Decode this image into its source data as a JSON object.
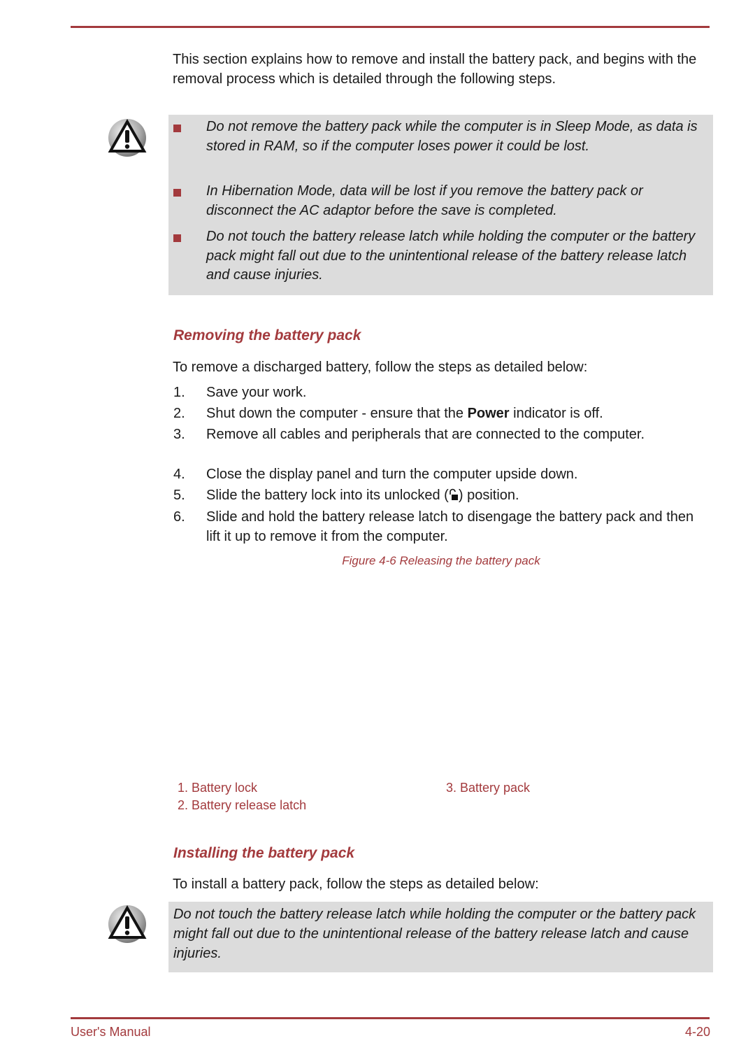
{
  "intro": "This section explains how to remove and install the battery pack, and begins with the removal process which is detailed through the following steps.",
  "caution_notes": [
    "Do not remove the battery pack while the computer is in Sleep Mode, as data is stored in RAM, so if the computer loses power it could be lost.",
    "In Hibernation Mode, data will be lost if you remove the battery pack or disconnect the AC adaptor before the save is completed.",
    "Do not touch the battery release latch while holding the computer or the battery pack might fall out due to the unintentional release of the battery release latch and cause injuries."
  ],
  "removing": {
    "heading": "Removing the battery pack",
    "lead": "To remove a discharged battery, follow the steps as detailed below:",
    "steps": [
      {
        "num": "1.",
        "text": "Save your work."
      },
      {
        "num": "2.",
        "pre": "Shut down the computer - ensure that the ",
        "bold": "Power",
        "post": " indicator is off."
      },
      {
        "num": "3.",
        "text": "Remove all cables and peripherals that are connected to the computer."
      },
      {
        "num": "4.",
        "text": "Close the display panel and turn the computer upside down."
      },
      {
        "num": "5.",
        "pre": "Slide the battery lock into its unlocked (",
        "icon": "unlocked-padlock-icon",
        "post": ") position."
      },
      {
        "num": "6.",
        "text": "Slide and hold the battery release latch to disengage the battery pack and then lift it up to remove it from the computer."
      }
    ],
    "figure_caption": "Figure 4-6 Releasing the battery pack",
    "legend": [
      "1. Battery lock",
      "2. Battery release latch",
      "3. Battery pack"
    ]
  },
  "installing": {
    "heading": "Installing the battery pack",
    "lead": "To install a battery pack, follow the steps as detailed below:",
    "caution": "Do not touch the battery release latch while holding the computer or the battery pack might fall out due to the unintentional release of the battery release latch and cause injuries."
  },
  "footer": {
    "left": "User's Manual",
    "page": "4-20"
  },
  "colors": {
    "accent": "#a33a3d",
    "note_background": "#dcdcdc"
  }
}
